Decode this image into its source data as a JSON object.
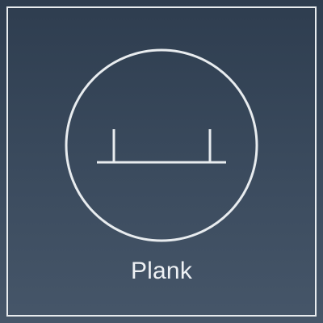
{
  "tile": {
    "label": "Plank",
    "icon": "plank-icon",
    "colors": {
      "background_top": "#2e3d4f",
      "background_bottom": "#465669",
      "stroke": "#e8ecef",
      "text": "#eef1f4"
    }
  }
}
